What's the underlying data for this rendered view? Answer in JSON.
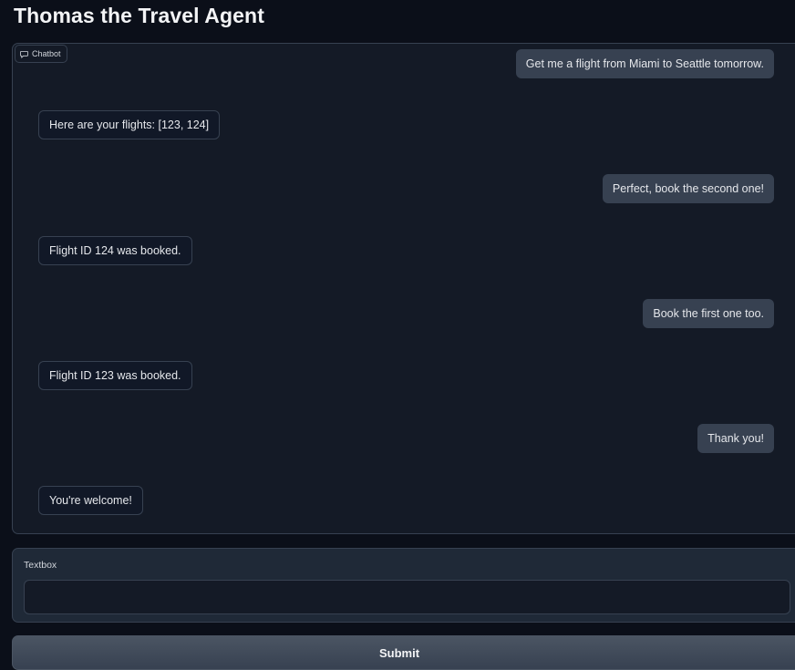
{
  "header": {
    "title": "Thomas the Travel Agent"
  },
  "chatbot": {
    "label": "Chatbot",
    "messages": [
      {
        "role": "user",
        "text": "Get me a flight from Miami to Seattle tomorrow."
      },
      {
        "role": "bot",
        "text": "Here are your flights: [123, 124]"
      },
      {
        "role": "user",
        "text": "Perfect, book the second one!"
      },
      {
        "role": "bot",
        "text": "Flight ID 124 was booked."
      },
      {
        "role": "user",
        "text": "Book the first one too."
      },
      {
        "role": "bot",
        "text": "Flight ID 123 was booked."
      },
      {
        "role": "user",
        "text": "Thank you!"
      },
      {
        "role": "bot",
        "text": "You're welcome!"
      }
    ]
  },
  "textbox": {
    "label": "Textbox",
    "value": ""
  },
  "submit": {
    "label": "Submit"
  },
  "icons": {
    "chatbot_label": "chat-bubble-icon",
    "resize": "resize-handle-icon"
  }
}
